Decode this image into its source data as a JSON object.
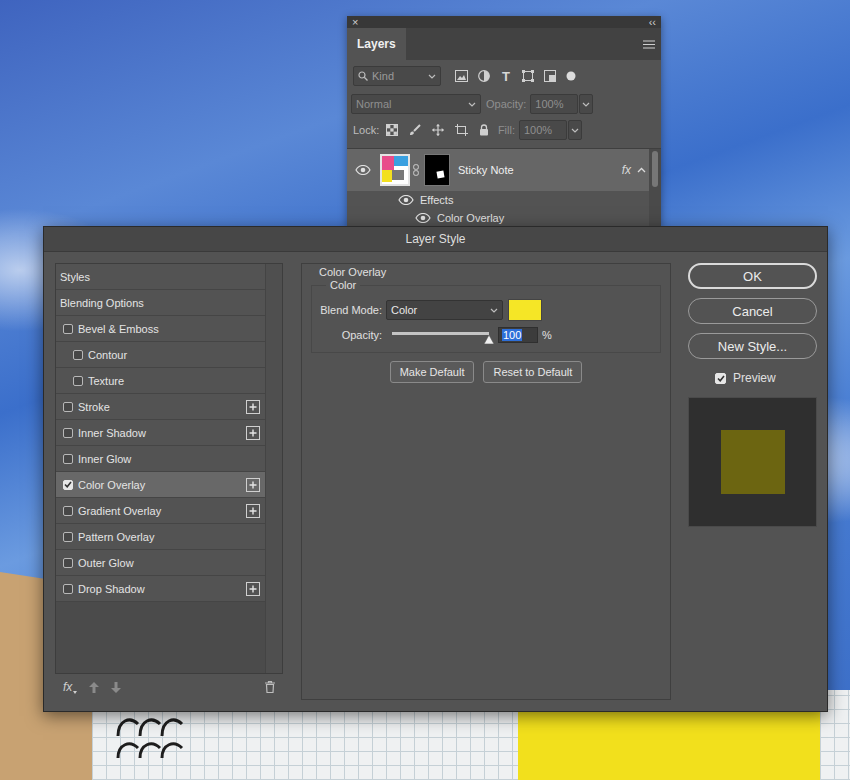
{
  "layers_panel": {
    "close": "×",
    "collapse": "‹‹",
    "title": "Layers",
    "filter": {
      "kind": "Kind",
      "type_icon": "T"
    },
    "blend_mode": "Normal",
    "opacity_label": "Opacity:",
    "opacity": "100%",
    "lock_label": "Lock:",
    "fill_label": "Fill:",
    "fill": "100%",
    "layers": [
      {
        "name": "Sticky Note",
        "visible": true,
        "selected": true,
        "fx": "fx",
        "expanded": true,
        "effects_label": "Effects",
        "effects_visible": true,
        "effects": [
          {
            "name": "Color Overlay",
            "visible": true
          }
        ]
      }
    ]
  },
  "dialog": {
    "title": "Layer Style",
    "styles": [
      {
        "label": "Styles",
        "kind": "header",
        "selected": false,
        "add": false
      },
      {
        "label": "Blending Options",
        "kind": "header",
        "selected": false,
        "add": false
      },
      {
        "label": "Bevel & Emboss",
        "kind": "checkbox",
        "checked": false,
        "selected": false,
        "add": false
      },
      {
        "label": "Contour",
        "kind": "subcheckbox",
        "checked": false,
        "selected": false,
        "add": false
      },
      {
        "label": "Texture",
        "kind": "subcheckbox",
        "checked": false,
        "selected": false,
        "add": false
      },
      {
        "label": "Stroke",
        "kind": "checkbox",
        "checked": false,
        "selected": false,
        "add": true
      },
      {
        "label": "Inner Shadow",
        "kind": "checkbox",
        "checked": false,
        "selected": false,
        "add": true
      },
      {
        "label": "Inner Glow",
        "kind": "checkbox",
        "checked": false,
        "selected": false,
        "add": false
      },
      {
        "label": "Color Overlay",
        "kind": "checkbox",
        "checked": true,
        "selected": true,
        "add": true
      },
      {
        "label": "Gradient Overlay",
        "kind": "checkbox",
        "checked": false,
        "selected": false,
        "add": true
      },
      {
        "label": "Pattern Overlay",
        "kind": "checkbox",
        "checked": false,
        "selected": false,
        "add": false
      },
      {
        "label": "Outer Glow",
        "kind": "checkbox",
        "checked": false,
        "selected": false,
        "add": false
      },
      {
        "label": "Drop Shadow",
        "kind": "checkbox",
        "checked": false,
        "selected": false,
        "add": true
      }
    ],
    "footer": {
      "fx": "fx"
    },
    "section": {
      "title": "Color Overlay",
      "group": "Color",
      "blend_mode_label": "Blend Mode:",
      "blend_mode": "Color",
      "swatch_color": "#f5e626",
      "opacity_label": "Opacity:",
      "opacity_level": 1,
      "opacity": "100",
      "opacity_unit": "%",
      "buttons": [
        "Make Default",
        "Reset to Default"
      ]
    },
    "buttons": [
      {
        "label": "OK",
        "default": true
      },
      {
        "label": "Cancel",
        "default": false
      },
      {
        "label": "New Style...",
        "default": false
      }
    ],
    "preview": {
      "label": "Preview",
      "checked": true
    }
  }
}
